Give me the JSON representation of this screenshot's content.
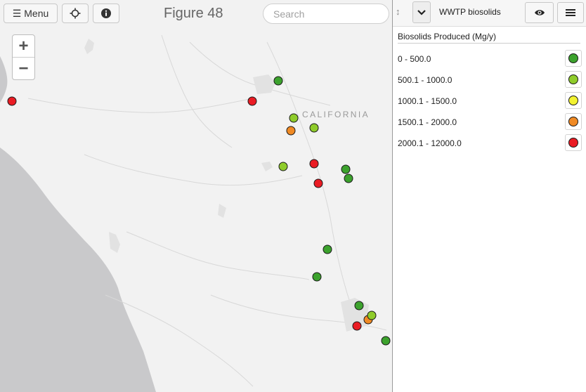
{
  "toolbar": {
    "menu_label": "Menu",
    "figure_title": "Figure 48",
    "search_placeholder": "Search"
  },
  "map": {
    "zoom_in": "+",
    "zoom_out": "−",
    "state_label": "CALIFORNIA"
  },
  "panel": {
    "layer_name": "WWTP biosolids",
    "legend_title": "Biosolids Produced (Mg/y)",
    "legend": [
      {
        "label": "0 - 500.0",
        "color": "#3ca22d"
      },
      {
        "label": "500.1 - 1000.0",
        "color": "#8fcc2b"
      },
      {
        "label": "1000.1 - 1500.0",
        "color": "#f2f230"
      },
      {
        "label": "1500.1 - 2000.0",
        "color": "#f08a24"
      },
      {
        "label": "2000.1 - 12000.0",
        "color": "#ea1c24"
      }
    ]
  }
}
